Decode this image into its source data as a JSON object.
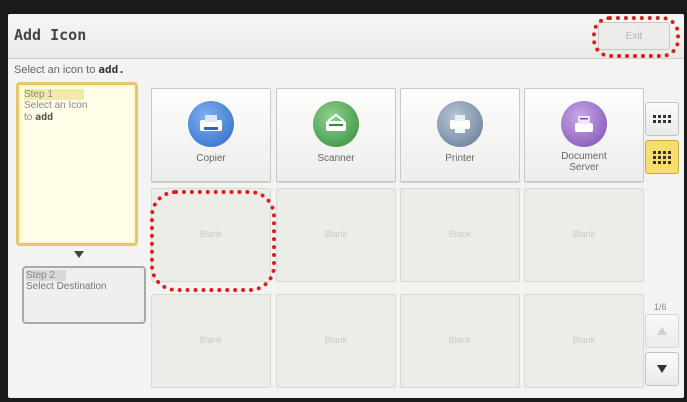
{
  "title": "Add Icon",
  "exit_label": "Exit",
  "instruction": {
    "prefix": "Select an icon to ",
    "emphasis": "add."
  },
  "step1": {
    "label": "Step 1",
    "line1": "Select an Icon",
    "line2": "to ",
    "line2_bold": "add"
  },
  "step2": {
    "label": "Step 2",
    "text": "Select Destination"
  },
  "tiles": [
    {
      "label": "Copier"
    },
    {
      "label": "Scanner"
    },
    {
      "label": "Printer"
    },
    {
      "label": "Document\nServer"
    },
    {
      "label": "Blank"
    },
    {
      "label": "Blank"
    },
    {
      "label": "Blank"
    },
    {
      "label": "Blank"
    },
    {
      "label": "Blank"
    },
    {
      "label": "Blank"
    },
    {
      "label": "Blank"
    },
    {
      "label": "Blank"
    }
  ],
  "icons": {
    "copier": "copier-icon",
    "scanner": "scanner-icon",
    "printer": "printer-icon",
    "document_server": "document-server-icon"
  },
  "page": "1/6",
  "colors": {
    "annotation": "#e01b1b",
    "step_active": "#e5c56d",
    "active_view": "#f6dd6e"
  }
}
